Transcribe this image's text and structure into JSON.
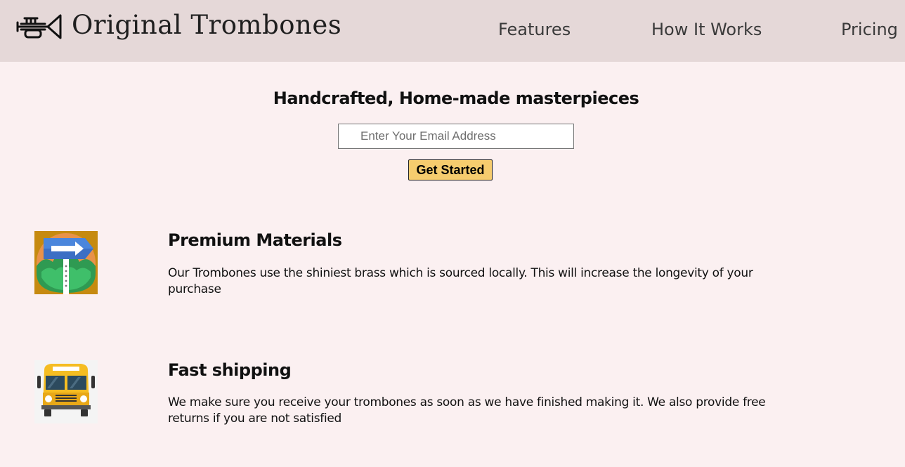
{
  "header": {
    "brand": "Original Trombones",
    "logo_icon": "trumpet-icon",
    "nav": [
      {
        "label": "Features"
      },
      {
        "label": "How It Works"
      },
      {
        "label": "Pricing"
      }
    ]
  },
  "hero": {
    "heading": "Handcrafted, Home-made masterpieces",
    "email_placeholder": "Enter Your Email Address",
    "email_value": "",
    "button_label": "Get Started"
  },
  "features": [
    {
      "icon": "signpost-icon",
      "title": "Premium Materials",
      "text": "Our Trombones use the shiniest brass which is sourced locally. This will increase the longevity of your purchase"
    },
    {
      "icon": "school-bus-icon",
      "title": "Fast shipping",
      "text": "We make sure you receive your trombones as soon as we have finished making it. We also provide free returns if you are not satisfied"
    }
  ],
  "colors": {
    "page_background": "#fbf0f1",
    "header_background": "#e5d8d8",
    "button_background": "#f6cc6e",
    "text": "#111111"
  }
}
